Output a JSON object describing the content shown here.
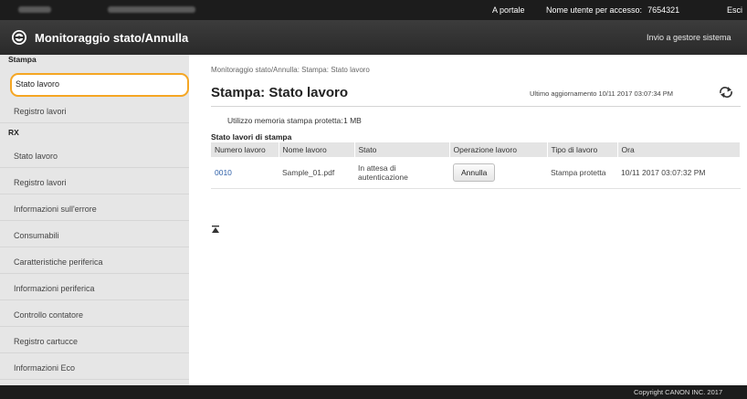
{
  "topbar": {
    "portal_link": "A portale",
    "user_label": "Nome utente per accesso:",
    "user_value": "7654321",
    "logout": "Esci"
  },
  "header": {
    "title": "Monitoraggio stato/Annulla",
    "send_to_admin": "Invio a gestore sistema"
  },
  "sidebar": {
    "sections": [
      {
        "label": "Stampa",
        "items": [
          {
            "label": "Stato lavoro",
            "active": true
          },
          {
            "label": "Registro lavori"
          }
        ]
      },
      {
        "label": "RX",
        "items": [
          {
            "label": "Stato lavoro"
          },
          {
            "label": "Registro lavori"
          }
        ]
      }
    ],
    "other_items": [
      "Informazioni sull'errore",
      "Consumabili",
      "Caratteristiche periferica",
      "Informazioni periferica",
      "Controllo contatore",
      "Registro cartucce",
      "Informazioni Eco"
    ]
  },
  "main": {
    "breadcrumb": "Monitoraggio stato/Annulla: Stampa: Stato lavoro",
    "page_title": "Stampa: Stato lavoro",
    "last_updated": "Ultimo aggiornamento 10/11 2017 03:07:34 PM",
    "memory_label": "Utilizzo memoria stampa protetta:",
    "memory_value": "1 MB",
    "table_title": "Stato lavori di stampa",
    "table": {
      "headers": [
        "Numero lavoro",
        "Nome lavoro",
        "Stato",
        "Operazione lavoro",
        "Tipo di lavoro",
        "Ora"
      ],
      "rows": [
        {
          "job_number": "0010",
          "job_name": "Sample_01.pdf",
          "status": "In attesa di autenticazione",
          "action": "Annulla",
          "job_type": "Stampa protetta",
          "time": "10/11 2017 03:07:32 PM"
        }
      ]
    }
  },
  "footer": {
    "copyright": "Copyright CANON INC. 2017"
  },
  "colors": {
    "active_outline": "#f5a623",
    "link": "#2d5fa8",
    "topbar_bg": "#1c1c1c",
    "sidebar_bg": "#e6e6e6"
  }
}
